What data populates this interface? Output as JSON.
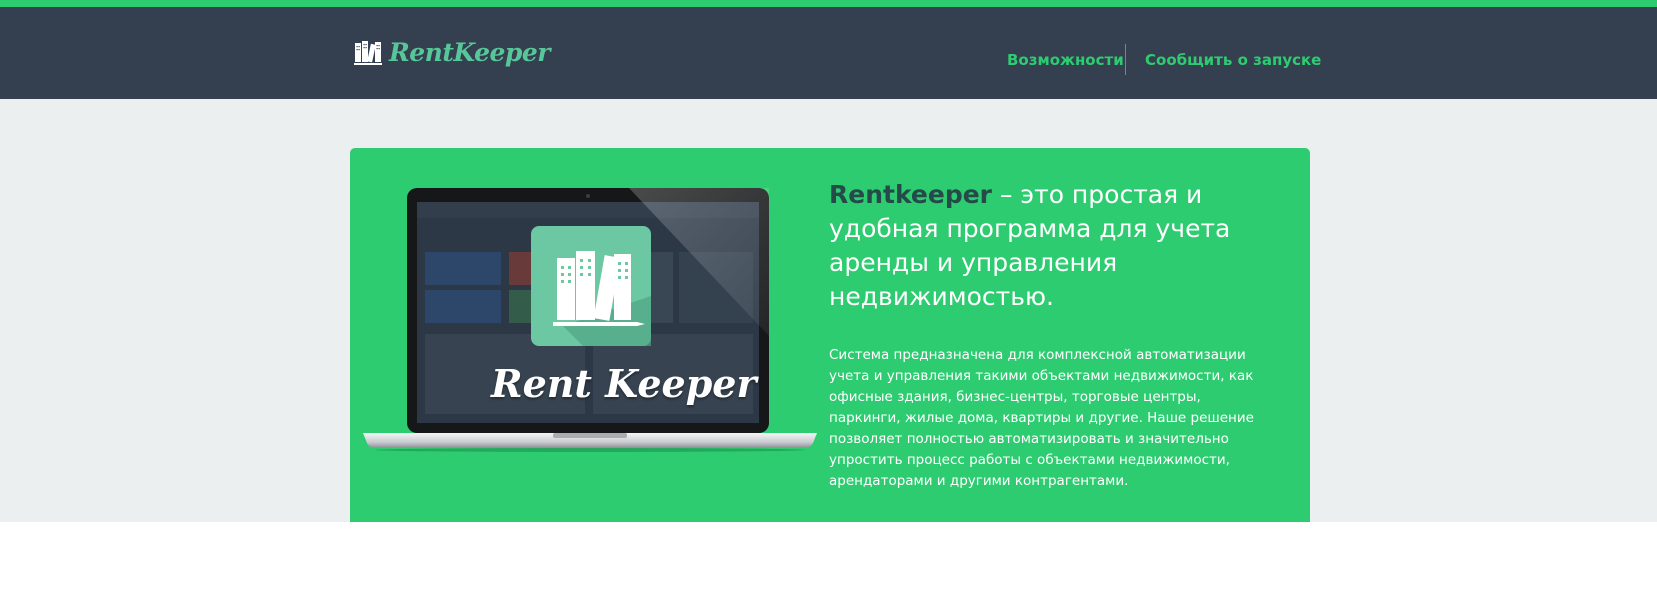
{
  "header": {
    "logo_text": "RentKeeper",
    "nav": {
      "features_label": "Возможности",
      "notify_label": "Сообщить о запуске"
    }
  },
  "hero": {
    "laptop_logo_text": "Rent Keeper",
    "headline_brand": "Rentkeeper",
    "headline_rest": " – это простая и удобная программа для учета аренды и управления недвижимостью.",
    "description": "Система предназначена для комплексной автоматизации учета и управления такими объектами недвижимости, как офисные здания, бизнес-центры, торговые центры, паркинги, жилые дома, квартиры и другие. Наше решение позволяет полностью автоматизировать и значительно упростить процесс работы с объектами недвижимости, арендаторами и другими контрагентами."
  },
  "colors": {
    "accent_green": "#2ecc71",
    "header_bg": "#34404f",
    "logo_green": "#57c79a",
    "page_band": "#ebeff0",
    "brand_dark": "#264a4a"
  },
  "icons": {
    "logo": "buildings-book-icon",
    "laptop_app_icon": "buildings-book-icon"
  }
}
